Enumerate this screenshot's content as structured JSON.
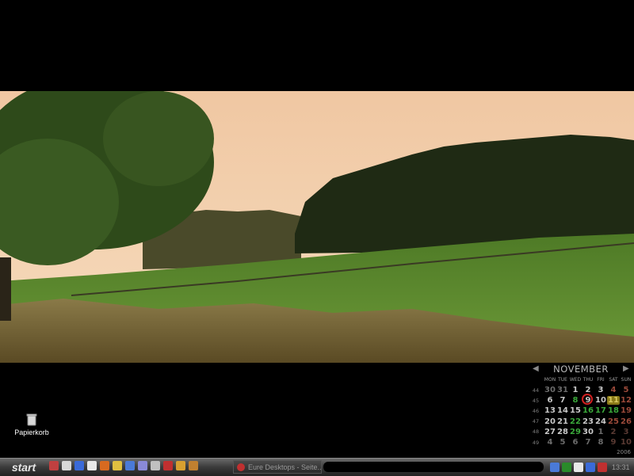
{
  "desktop": {
    "icons": [
      {
        "label": "Papierkorb",
        "icon": "recycle-bin-icon"
      }
    ]
  },
  "calendar": {
    "month": "NOVEMBER",
    "year": "2006",
    "weekdays": [
      "MON",
      "TUE",
      "WED",
      "THU",
      "FRI",
      "SAT",
      "SUN"
    ],
    "weeks": [
      {
        "wk": "44",
        "days": [
          "30",
          "31",
          "1",
          "2",
          "3",
          "4",
          "5"
        ]
      },
      {
        "wk": "45",
        "days": [
          "6",
          "7",
          "8",
          "9",
          "10",
          "11",
          "12"
        ]
      },
      {
        "wk": "46",
        "days": [
          "13",
          "14",
          "15",
          "16",
          "17",
          "18",
          "19"
        ]
      },
      {
        "wk": "47",
        "days": [
          "20",
          "21",
          "22",
          "23",
          "24",
          "25",
          "26"
        ]
      },
      {
        "wk": "48",
        "days": [
          "27",
          "28",
          "29",
          "30",
          "1",
          "2",
          "3"
        ]
      },
      {
        "wk": "49",
        "days": [
          "4",
          "5",
          "6",
          "7",
          "8",
          "9",
          "10"
        ]
      }
    ],
    "today": "9",
    "highlighted": "11"
  },
  "taskbar": {
    "start_label": "start",
    "quicklaunch_icons": [
      "media-icon",
      "explorer-icon",
      "browser-icon",
      "floppy-icon",
      "firefox-icon",
      "folder-icon",
      "globe-icon",
      "app-icon",
      "settings-icon",
      "opera-icon",
      "tool-icon",
      "mail-icon"
    ],
    "task_label": "Eure Desktops - Seite...",
    "tray_icons": [
      "network-icon",
      "app-icon",
      "volume-icon",
      "shield-icon",
      "antivirus-icon"
    ],
    "clock": "13:31"
  },
  "colors": {
    "taskbar": "#3a3a3a",
    "sky": "#f2c9a0",
    "grass": "#5b8a2e"
  }
}
